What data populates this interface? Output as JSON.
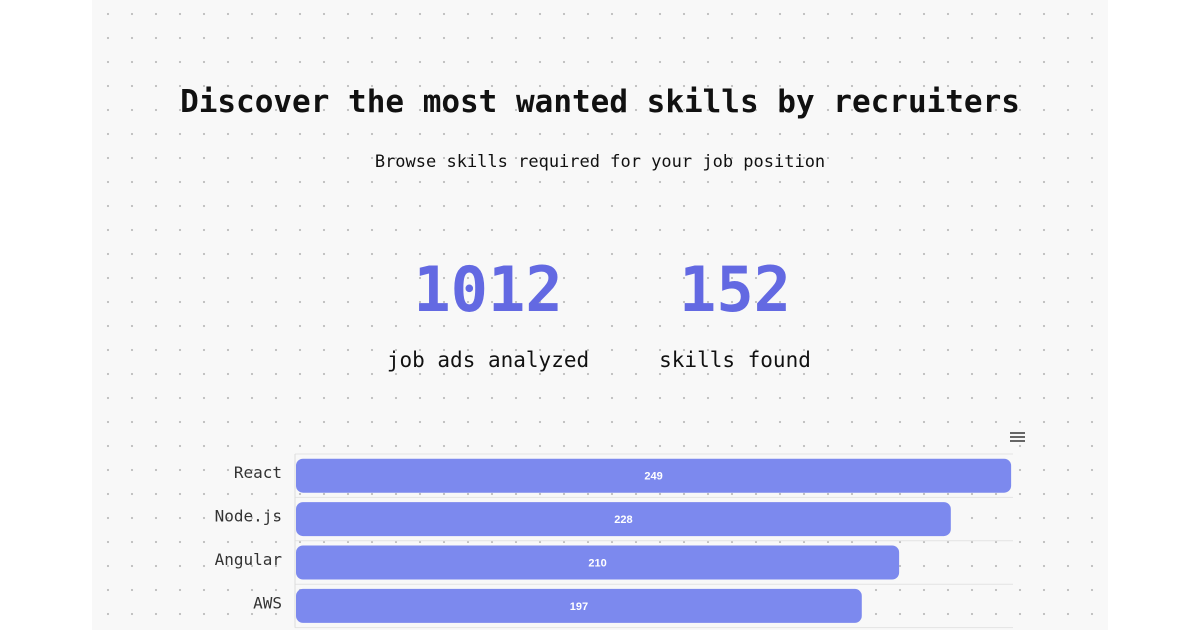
{
  "hero": {
    "title": "Discover the most wanted skills by recruiters",
    "subtitle": "Browse skills required for your job position"
  },
  "stats": {
    "job_ads": {
      "value": "1012",
      "label": "job ads analyzed"
    },
    "skills": {
      "value": "152",
      "label": "skills found"
    }
  },
  "chart_menu_icon": "menu-icon",
  "colors": {
    "accent": "#6369e2",
    "bar": "#7c89ee",
    "text": "#111111"
  },
  "chart_data": {
    "type": "bar",
    "orientation": "horizontal",
    "categories": [
      "React",
      "Node.js",
      "Angular",
      "AWS"
    ],
    "values": [
      249,
      228,
      210,
      197
    ],
    "xlim": [
      0,
      250
    ],
    "grid": true,
    "data_labels": true
  }
}
